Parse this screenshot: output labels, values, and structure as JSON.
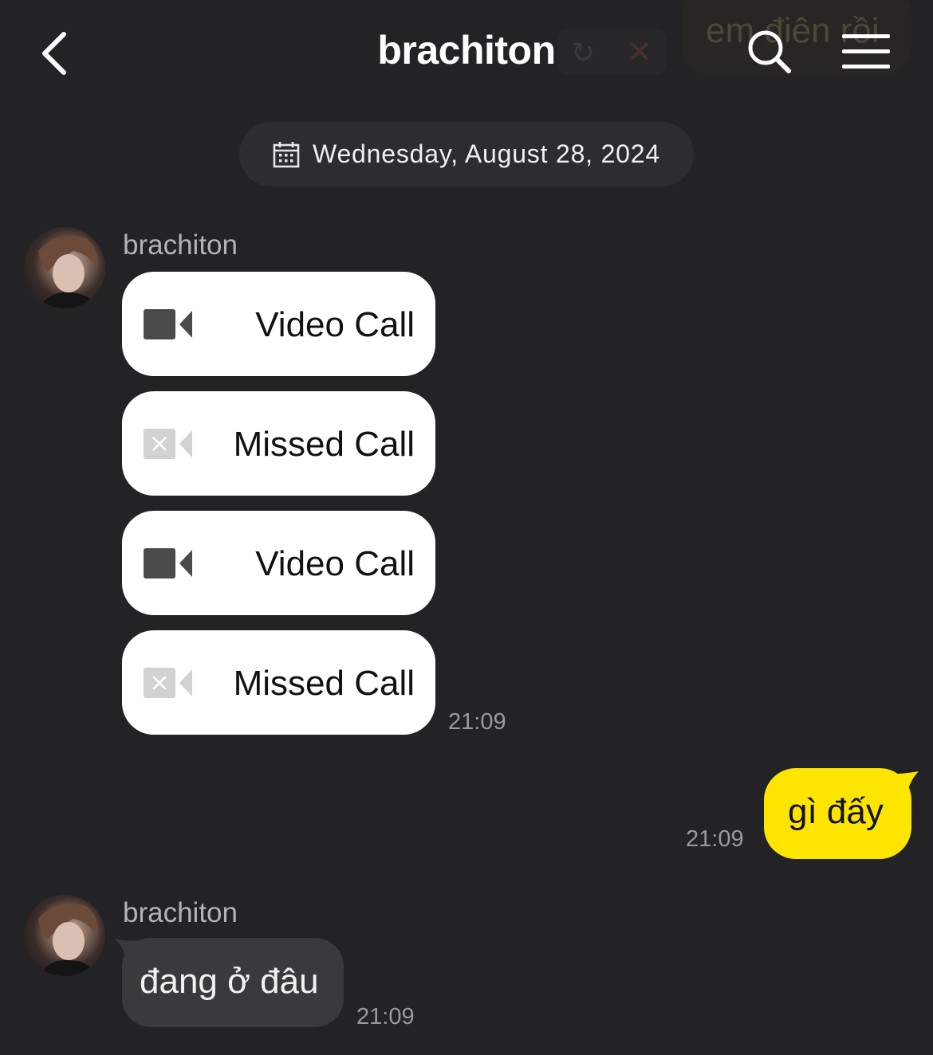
{
  "header": {
    "title": "brachiton",
    "back_icon": "chevron-left-icon",
    "search_icon": "search-icon",
    "menu_icon": "hamburger-menu-icon",
    "ghost_preview_text": "em điên rồi"
  },
  "date_divider": {
    "icon": "calendar-icon",
    "text": "Wednesday, August 28, 2024"
  },
  "messages": [
    {
      "sender": "brachiton",
      "direction": "incoming",
      "calls": [
        {
          "type": "video",
          "label": "Video Call",
          "icon": "video-camera-icon"
        },
        {
          "type": "missed",
          "label": "Missed Call",
          "icon": "video-camera-missed-icon"
        },
        {
          "type": "video",
          "label": "Video Call",
          "icon": "video-camera-icon"
        },
        {
          "type": "missed",
          "label": "Missed Call",
          "icon": "video-camera-missed-icon"
        }
      ],
      "time": "21:09"
    },
    {
      "direction": "outgoing",
      "text": "gì đấy",
      "time": "21:09"
    },
    {
      "sender": "brachiton",
      "direction": "incoming",
      "text": "đang ở đâu",
      "time": "21:09"
    }
  ],
  "colors": {
    "background": "#232325",
    "outgoing_bubble": "#fee500",
    "incoming_bubble": "#3a3a3d",
    "call_bubble": "#ffffff",
    "date_pill": "#2d2d30"
  }
}
